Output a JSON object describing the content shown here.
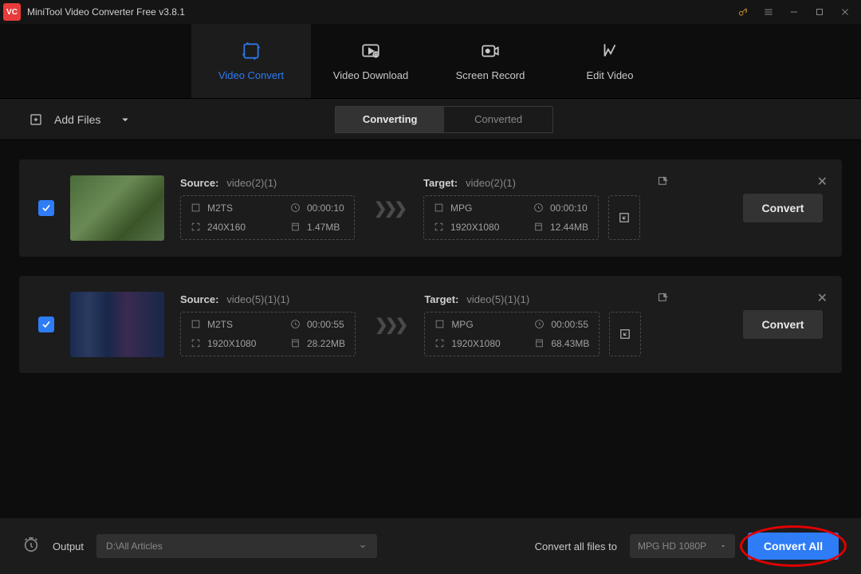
{
  "titlebar": {
    "title": "MiniTool Video Converter Free v3.8.1"
  },
  "nav": {
    "convert": "Video Convert",
    "download": "Video Download",
    "record": "Screen Record",
    "edit": "Edit Video"
  },
  "toolbar": {
    "add_files": "Add Files",
    "converting": "Converting",
    "converted": "Converted"
  },
  "labels": {
    "source": "Source:",
    "target": "Target:",
    "convert": "Convert"
  },
  "rows": [
    {
      "source_name": "video(2)(1)",
      "target_name": "video(2)(1)",
      "src": {
        "fmt": "M2TS",
        "dur": "00:00:10",
        "res": "240X160",
        "size": "1.47MB"
      },
      "tgt": {
        "fmt": "MPG",
        "dur": "00:00:10",
        "res": "1920X1080",
        "size": "12.44MB"
      }
    },
    {
      "source_name": "video(5)(1)(1)",
      "target_name": "video(5)(1)(1)",
      "src": {
        "fmt": "M2TS",
        "dur": "00:00:55",
        "res": "1920X1080",
        "size": "28.22MB"
      },
      "tgt": {
        "fmt": "MPG",
        "dur": "00:00:55",
        "res": "1920X1080",
        "size": "68.43MB"
      }
    }
  ],
  "footer": {
    "output_label": "Output",
    "output_path": "D:\\All Articles",
    "convert_all_label": "Convert all files to",
    "format": "MPG HD 1080P",
    "convert_all": "Convert All"
  }
}
